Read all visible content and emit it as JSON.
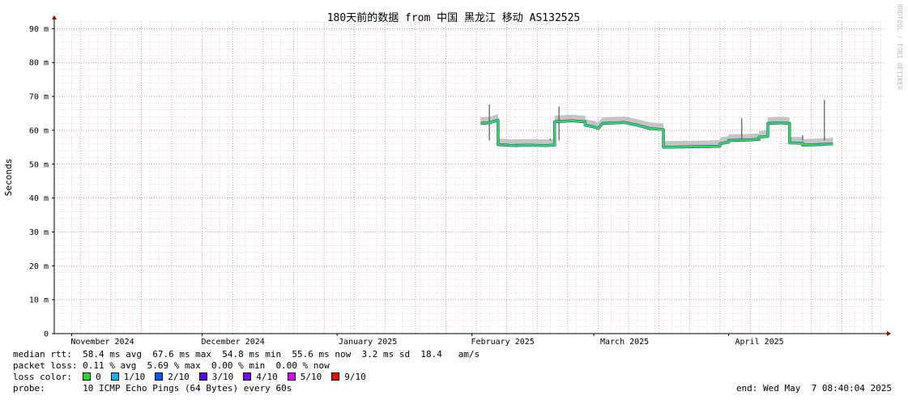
{
  "chart_data": {
    "type": "line",
    "title": "180天前的数据 from 中国 黑龙江 移动 AS132525",
    "ylabel": "Seconds",
    "side_label": "RRDTOOL / TOBI OETIKER",
    "ylim": [
      0,
      92
    ],
    "y_ticks": [
      {
        "value": 0,
        "label": "0"
      },
      {
        "value": 10,
        "label": "10 m"
      },
      {
        "value": 20,
        "label": "20 m"
      },
      {
        "value": 30,
        "label": "30 m"
      },
      {
        "value": 40,
        "label": "40 m"
      },
      {
        "value": 50,
        "label": "50 m"
      },
      {
        "value": 60,
        "label": "60 m"
      },
      {
        "value": 70,
        "label": "70 m"
      },
      {
        "value": 80,
        "label": "80 m"
      },
      {
        "value": 90,
        "label": "90 m"
      }
    ],
    "x_range": [
      "2024-10-28",
      "2025-05-07"
    ],
    "x_ticks": [
      {
        "date": "2024-11-01",
        "label": "November 2024"
      },
      {
        "date": "2024-12-01",
        "label": "December 2024"
      },
      {
        "date": "2025-01-01",
        "label": "January 2025"
      },
      {
        "date": "2025-02-01",
        "label": "February 2025"
      },
      {
        "date": "2025-03-01",
        "label": "March 2025"
      },
      {
        "date": "2025-04-01",
        "label": "April 2025"
      }
    ],
    "grid": true,
    "series": [
      {
        "name": "median rtt",
        "color": "#33dd33",
        "points": [
          [
            "2025-02-03",
            62.0
          ],
          [
            "2025-02-05",
            62.2
          ],
          [
            "2025-02-07",
            63.0
          ],
          [
            "2025-02-07",
            55.8
          ],
          [
            "2025-02-10",
            55.5
          ],
          [
            "2025-02-14",
            55.6
          ],
          [
            "2025-02-18",
            55.5
          ],
          [
            "2025-02-20",
            55.6
          ],
          [
            "2025-02-20",
            62.5
          ],
          [
            "2025-02-24",
            62.8
          ],
          [
            "2025-02-27",
            62.5
          ],
          [
            "2025-02-27",
            61.5
          ],
          [
            "2025-03-01",
            61.0
          ],
          [
            "2025-03-02",
            60.5
          ],
          [
            "2025-03-03",
            62.0
          ],
          [
            "2025-03-08",
            62.3
          ],
          [
            "2025-03-11",
            61.5
          ],
          [
            "2025-03-14",
            60.5
          ],
          [
            "2025-03-17",
            60.2
          ],
          [
            "2025-03-17",
            55.0
          ],
          [
            "2025-03-22",
            55.1
          ],
          [
            "2025-03-27",
            55.2
          ],
          [
            "2025-03-30",
            55.3
          ],
          [
            "2025-03-30",
            56.0
          ],
          [
            "2025-04-01",
            56.5
          ],
          [
            "2025-04-01",
            57.0
          ],
          [
            "2025-04-05",
            57.1
          ],
          [
            "2025-04-08",
            57.3
          ],
          [
            "2025-04-08",
            58.0
          ],
          [
            "2025-04-10",
            58.2
          ],
          [
            "2025-04-10",
            62.0
          ],
          [
            "2025-04-13",
            62.2
          ],
          [
            "2025-04-15",
            62.0
          ],
          [
            "2025-04-15",
            56.3
          ],
          [
            "2025-04-18",
            56.2
          ],
          [
            "2025-04-18",
            55.6
          ],
          [
            "2025-04-22",
            55.8
          ],
          [
            "2025-04-25",
            56.0
          ]
        ]
      }
    ],
    "spikes": [
      {
        "date": "2025-02-05",
        "value": 67.6
      },
      {
        "date": "2025-02-19",
        "value": 57.5
      },
      {
        "date": "2025-02-21",
        "value": 67.0
      },
      {
        "date": "2025-04-04",
        "value": 63.5
      },
      {
        "date": "2025-04-18",
        "value": 58.5
      },
      {
        "date": "2025-04-23",
        "value": 69.0
      }
    ]
  },
  "legend": {
    "median_rtt_label": "median rtt:",
    "median_rtt_values": "58.4 ms avg  67.6 ms max  54.8 ms min  55.6 ms now  3.2 ms sd  18.4   am/s",
    "packet_loss_label": "packet loss:",
    "packet_loss_values": "0.11 % avg  5.69 % max  0.00 % min  0.00 % now",
    "loss_color_label": "loss color:",
    "loss_colors": [
      {
        "label": "0",
        "color": "#22dd22"
      },
      {
        "label": "1/10",
        "color": "#00b8ff"
      },
      {
        "label": "2/10",
        "color": "#0059ff"
      },
      {
        "label": "3/10",
        "color": "#5e00ff"
      },
      {
        "label": "4/10",
        "color": "#7e00ff"
      },
      {
        "label": "5/10",
        "color": "#dd00ff"
      },
      {
        "label": "9/10",
        "color": "#ff0000"
      }
    ],
    "probe_label": "probe:",
    "probe_value": "10 ICMP Echo Pings (64 Bytes) every 60s",
    "end_text": "end: Wed May  7 08:40:04 2025"
  }
}
